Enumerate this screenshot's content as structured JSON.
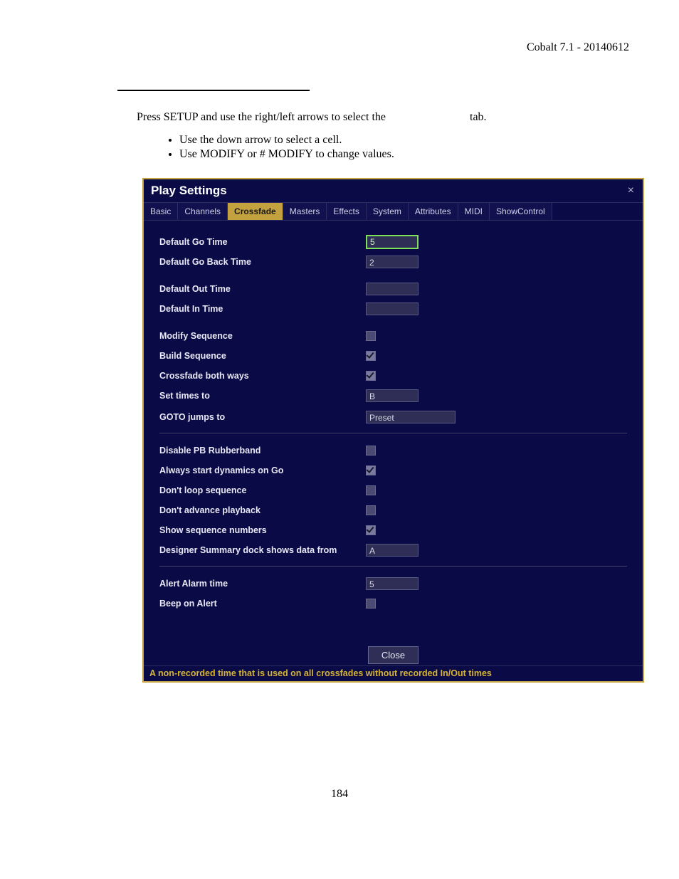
{
  "doc": {
    "header": "Cobalt 7.1 - 20140612",
    "intro_prefix": "Press SETUP and use the right/left arrows to select the",
    "intro_suffix": "tab.",
    "bullets": [
      "Use the down arrow to select a cell.",
      "Use MODIFY or # MODIFY to change values."
    ],
    "page_number": "184"
  },
  "window": {
    "title": "Play Settings",
    "tabs": [
      "Basic",
      "Channels",
      "Crossfade",
      "Masters",
      "Effects",
      "System",
      "Attributes",
      "MIDI",
      "ShowControl"
    ],
    "selected_tab_index": 2,
    "close_label": "Close",
    "help_text": "A non-recorded time that is used on all crossfades without recorded In/Out times",
    "groups": [
      {
        "rows": [
          {
            "label": "Default Go Time",
            "type": "field",
            "value": "5",
            "active": true,
            "width": "w-small"
          },
          {
            "label": "Default Go Back Time",
            "type": "field",
            "value": "2",
            "active": false,
            "width": "w-small"
          },
          {
            "label": "Default Out Time",
            "type": "field",
            "value": "",
            "active": false,
            "width": "w-small",
            "pad_top": true
          },
          {
            "label": "Default In Time",
            "type": "field",
            "value": "",
            "active": false,
            "width": "w-small"
          },
          {
            "label": "Modify Sequence",
            "type": "checkbox",
            "checked": false,
            "pad_top": true
          },
          {
            "label": "Build Sequence",
            "type": "checkbox",
            "checked": true
          },
          {
            "label": "Crossfade both ways",
            "type": "checkbox",
            "checked": true
          },
          {
            "label": "Set times to",
            "type": "field",
            "value": "B",
            "active": false,
            "width": "w-med"
          },
          {
            "label": "GOTO jumps to",
            "type": "field",
            "value": "Preset",
            "active": false,
            "width": "w-wide",
            "pad_top_small": true
          }
        ]
      },
      {
        "rows": [
          {
            "label": "Disable PB Rubberband",
            "type": "checkbox",
            "checked": false
          },
          {
            "label": "Always start dynamics on Go",
            "type": "checkbox",
            "checked": true
          },
          {
            "label": "Don't loop sequence",
            "type": "checkbox",
            "checked": false
          },
          {
            "label": "Don't advance playback",
            "type": "checkbox",
            "checked": false
          },
          {
            "label": "Show sequence numbers",
            "type": "checkbox",
            "checked": true
          },
          {
            "label": "Designer Summary dock shows data from",
            "type": "field",
            "value": "A",
            "active": false,
            "width": "w-med"
          }
        ]
      },
      {
        "rows": [
          {
            "label": "Alert Alarm time",
            "type": "field",
            "value": "5",
            "active": false,
            "width": "w-small"
          },
          {
            "label": "Beep on Alert",
            "type": "checkbox",
            "checked": false
          }
        ]
      }
    ]
  }
}
